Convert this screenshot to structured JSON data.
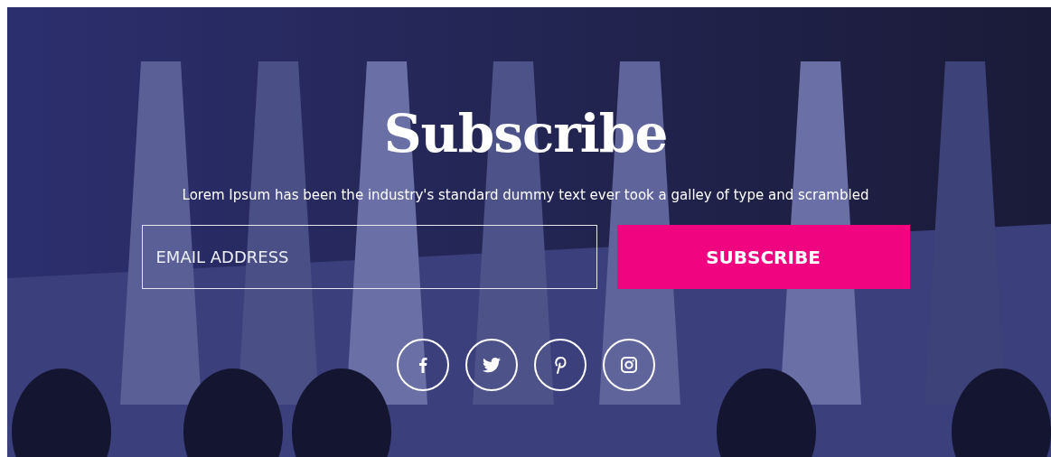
{
  "title": "Subscribe",
  "subtitle": "Lorem Ipsum has been the industry's standard dummy text ever took a galley of type and scrambled",
  "email": {
    "placeholder": "EMAIL ADDRESS"
  },
  "button": "SUBSCRIBE",
  "social_links": [
    {
      "kind": "facebook"
    },
    {
      "kind": "twitter"
    },
    {
      "kind": "pinterest"
    },
    {
      "kind": "instagram"
    }
  ]
}
